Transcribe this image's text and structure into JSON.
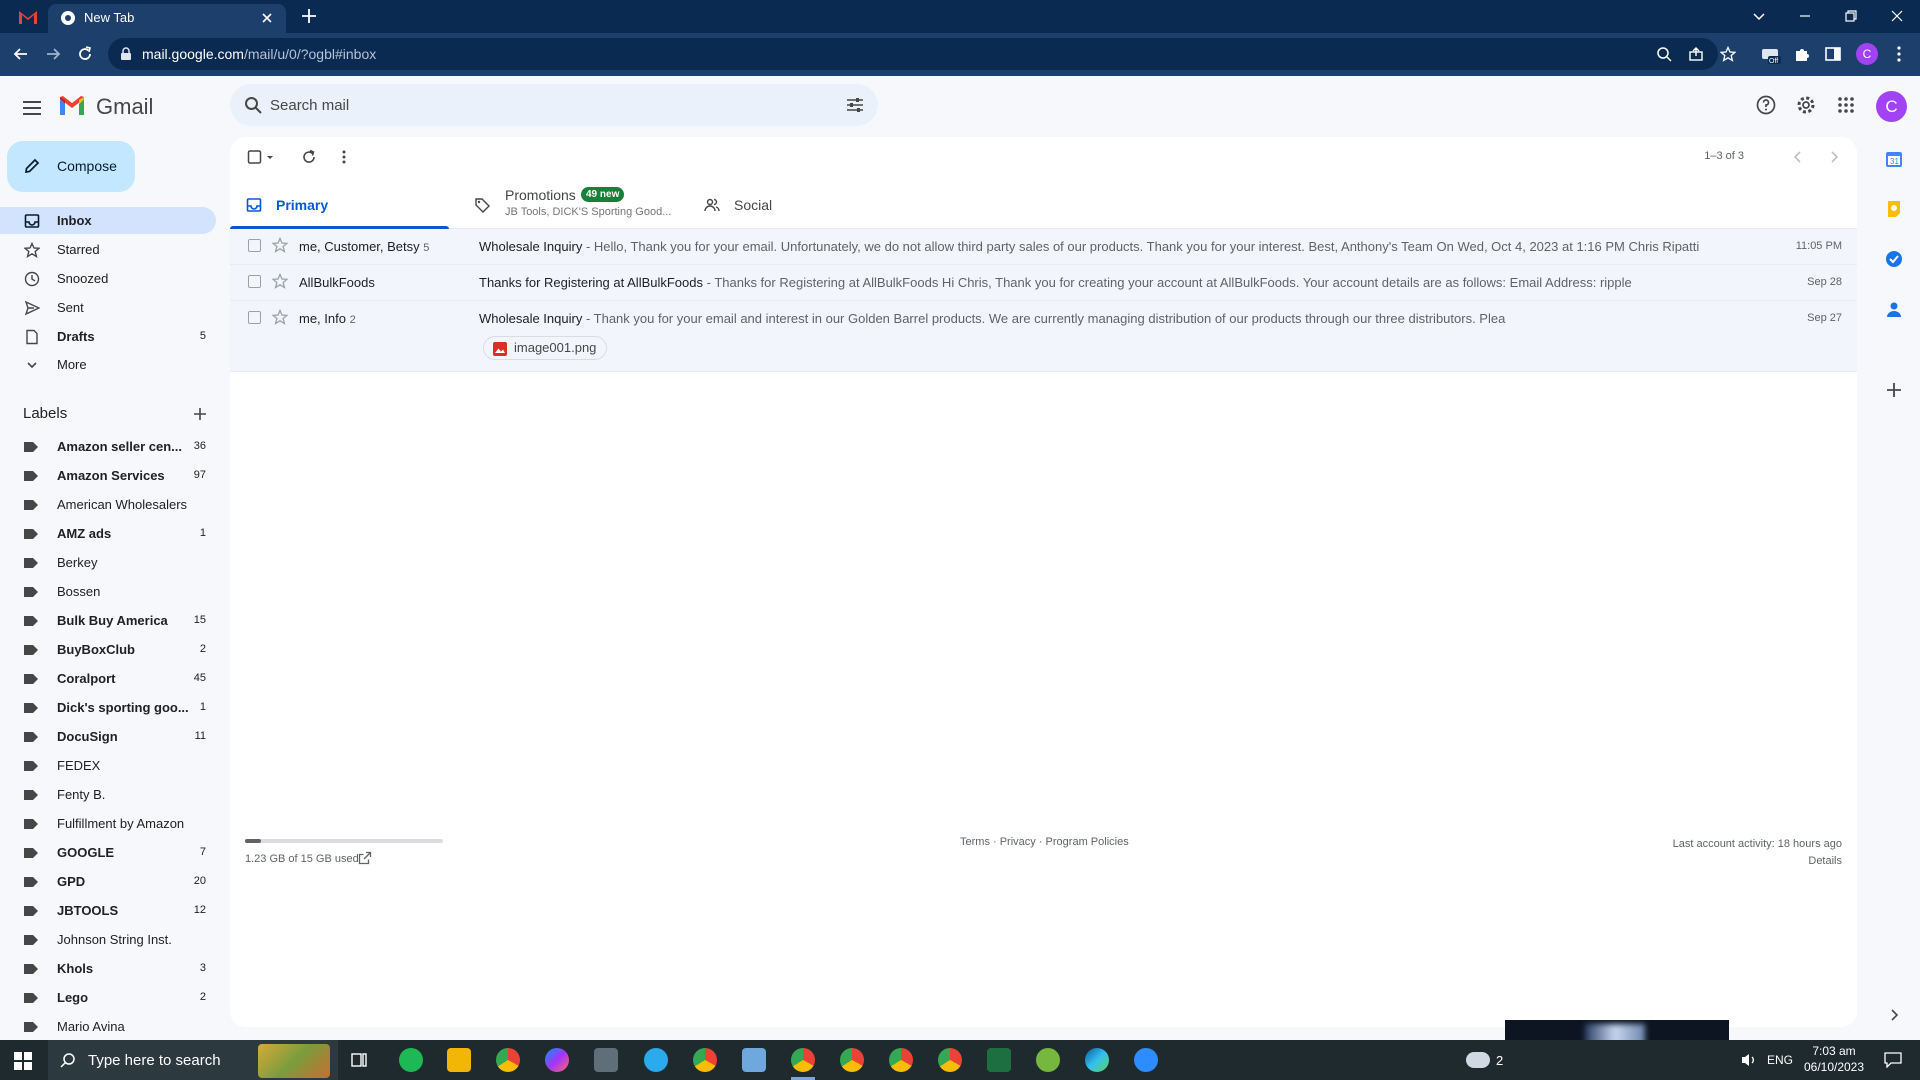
{
  "browser": {
    "tab_title": "New Tab",
    "url_domain": "mail.google.com",
    "url_path": "/mail/u/0/?ogbl#inbox",
    "profile_letter": "C"
  },
  "header": {
    "brand": "Gmail",
    "search_placeholder": "Search mail",
    "avatar_letter": "C"
  },
  "sidebar": {
    "compose": "Compose",
    "items": [
      {
        "label": "Inbox",
        "count": ""
      },
      {
        "label": "Starred",
        "count": ""
      },
      {
        "label": "Snoozed",
        "count": ""
      },
      {
        "label": "Sent",
        "count": ""
      },
      {
        "label": "Drafts",
        "count": "5"
      },
      {
        "label": "More",
        "count": ""
      }
    ],
    "labels_title": "Labels",
    "labels": [
      {
        "label": "Amazon seller cen...",
        "count": "36"
      },
      {
        "label": "Amazon Services",
        "count": "97"
      },
      {
        "label": "American Wholesalers",
        "count": ""
      },
      {
        "label": "AMZ ads",
        "count": "1"
      },
      {
        "label": "Berkey",
        "count": ""
      },
      {
        "label": "Bossen",
        "count": ""
      },
      {
        "label": "Bulk Buy America",
        "count": "15"
      },
      {
        "label": "BuyBoxClub",
        "count": "2"
      },
      {
        "label": "Coralport",
        "count": "45"
      },
      {
        "label": "Dick's sporting goo...",
        "count": "1"
      },
      {
        "label": "DocuSign",
        "count": "11"
      },
      {
        "label": "FEDEX",
        "count": ""
      },
      {
        "label": "Fenty B.",
        "count": ""
      },
      {
        "label": "Fulfillment by Amazon",
        "count": ""
      },
      {
        "label": "GOOGLE",
        "count": "7"
      },
      {
        "label": "GPD",
        "count": "20"
      },
      {
        "label": "JBTOOLS",
        "count": "12"
      },
      {
        "label": "Johnson String Inst.",
        "count": ""
      },
      {
        "label": "Khols",
        "count": "3"
      },
      {
        "label": "Lego",
        "count": "2"
      },
      {
        "label": "Mario Avina",
        "count": ""
      }
    ]
  },
  "toolbar": {
    "pager": "1–3 of 3"
  },
  "tabs": [
    {
      "label": "Primary"
    },
    {
      "label": "Promotions",
      "badge": "49 new",
      "sub": "JB Tools, DICK'S Sporting Good..."
    },
    {
      "label": "Social"
    }
  ],
  "emails": [
    {
      "sender": "me, Customer, Betsy",
      "count": "5",
      "subject": "Wholesale Inquiry",
      "snippet": " - Hello, Thank you for your email. Unfortunately, we do not allow third party sales of our products. Thank you for your interest. Best, Anthony's Team On Wed, Oct 4, 2023 at 1:16 PM Chris Ripatti",
      "date": "11:05 PM"
    },
    {
      "sender": "AllBulkFoods",
      "count": "",
      "subject": "Thanks for Registering at AllBulkFoods",
      "snippet": " - Thanks for Registering at AllBulkFoods Hi Chris, Thank you for creating your account at AllBulkFoods. Your account details are as follows: Email Address: ripple",
      "date": "Sep 28"
    },
    {
      "sender": "me, Info",
      "count": "2",
      "subject": "Wholesale Inquiry",
      "snippet": " - Thank you for your email and interest in our Golden Barrel products. We are currently managing distribution of our products through our three distributors. Plea",
      "date": "Sep 27",
      "attachment": "image001.png"
    }
  ],
  "footer": {
    "storage": "1.23 GB of 15 GB used",
    "storage_fraction": 0.082,
    "links": "Terms · Privacy · Program Policies",
    "activity": "Last account activity: 18 hours ago",
    "details": "Details"
  },
  "taskbar": {
    "search_placeholder": "Type here to search",
    "weather": "2",
    "lang": "ENG",
    "time": "7:03 am",
    "date": "06/10/2023"
  }
}
